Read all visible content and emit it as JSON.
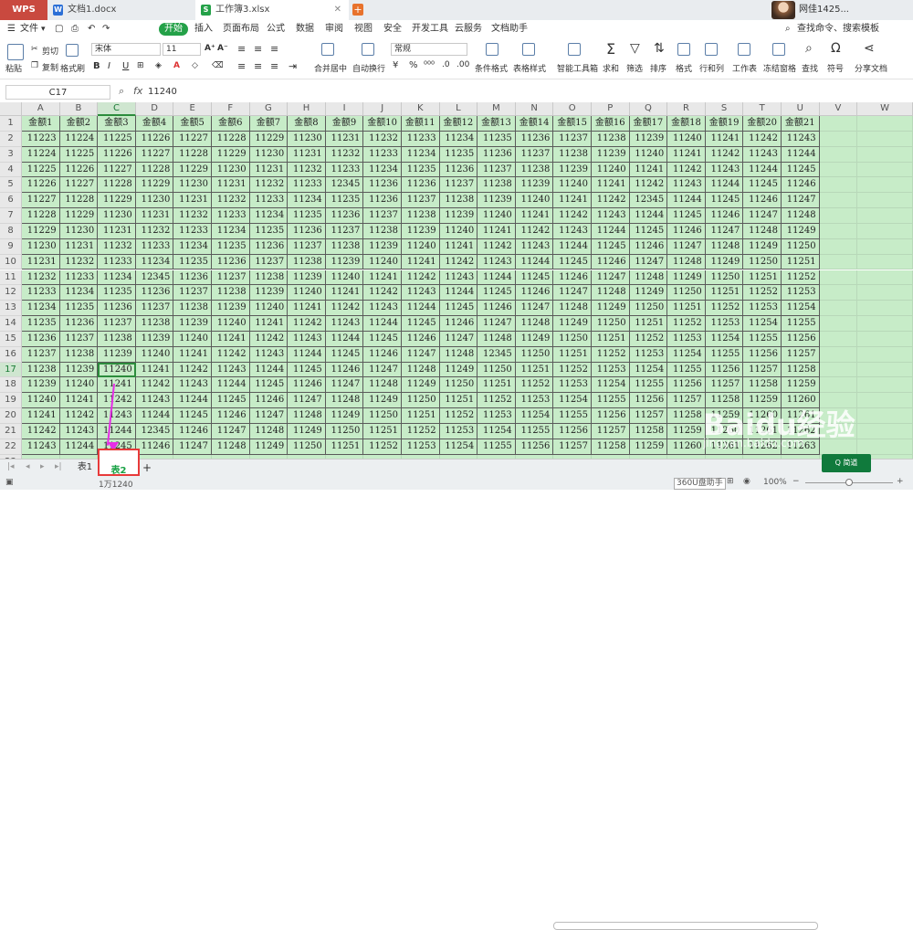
{
  "app": {
    "logo": "WPS",
    "tabs": [
      {
        "label": "文档1.docx",
        "icon": "W",
        "color": "#2b6fd6"
      },
      {
        "label": "工作簿3.xlsx",
        "icon": "S",
        "color": "#24a148"
      }
    ],
    "user_name": "网佳1425..."
  },
  "menu": {
    "file": "文件",
    "items": [
      "开始",
      "插入",
      "页面布局",
      "公式",
      "数据",
      "审阅",
      "视图",
      "安全",
      "开发工具",
      "云服务",
      "文档助手"
    ],
    "search": "查找命令、搜索模板"
  },
  "toolbar": {
    "paste": "粘贴",
    "cut": "剪切",
    "copy": "复制",
    "format_painter": "格式刷",
    "font_name": "宋体",
    "font_size": "11",
    "bold": "B",
    "italic": "I",
    "underline": "U",
    "merge": "合并居中",
    "wrap": "自动换行",
    "number_format": "常规",
    "cond_format": "条件格式",
    "table_style": "表格样式",
    "smart_toolbox": "智能工具箱",
    "sum": "求和",
    "filter": "筛选",
    "sort": "排序",
    "format": "格式",
    "row_col": "行和列",
    "worksheet": "工作表",
    "freeze": "冻结窗格",
    "find": "查找",
    "symbol": "符号",
    "share": "分享文档"
  },
  "formula_bar": {
    "cell_ref": "C17",
    "fx": "fx",
    "value": "11240"
  },
  "sheet": {
    "columns": [
      "A",
      "B",
      "C",
      "D",
      "E",
      "F",
      "G",
      "H",
      "I",
      "J",
      "K",
      "L",
      "M",
      "N",
      "O",
      "P",
      "Q",
      "R",
      "S",
      "T",
      "U",
      "V",
      "W"
    ],
    "selected_column": "C",
    "selected_row": "17",
    "rows": [
      [
        "金额1",
        "金额2",
        "金额3",
        "金额4",
        "金额5",
        "金额6",
        "金额7",
        "金额8",
        "金额9",
        "金额10",
        "金额11",
        "金额12",
        "金额13",
        "金额14",
        "金额15",
        "金额16",
        "金额17",
        "金额18",
        "金额19",
        "金额20",
        "金额21"
      ],
      [
        "11223",
        "11224",
        "11225",
        "11226",
        "11227",
        "11228",
        "11229",
        "11230",
        "11231",
        "11232",
        "11233",
        "11234",
        "11235",
        "11236",
        "11237",
        "11238",
        "11239",
        "11240",
        "11241",
        "11242",
        "11243"
      ],
      [
        "11224",
        "11225",
        "11226",
        "11227",
        "11228",
        "11229",
        "11230",
        "11231",
        "11232",
        "11233",
        "11234",
        "11235",
        "11236",
        "11237",
        "11238",
        "11239",
        "11240",
        "11241",
        "11242",
        "11243",
        "11244"
      ],
      [
        "11225",
        "11226",
        "11227",
        "11228",
        "11229",
        "11230",
        "11231",
        "11232",
        "11233",
        "11234",
        "11235",
        "11236",
        "11237",
        "11238",
        "11239",
        "11240",
        "11241",
        "11242",
        "11243",
        "11244",
        "11245"
      ],
      [
        "11226",
        "11227",
        "11228",
        "11229",
        "11230",
        "11231",
        "11232",
        "11233",
        "12345",
        "11236",
        "11236",
        "11237",
        "11238",
        "11239",
        "11240",
        "11241",
        "11242",
        "11243",
        "11244",
        "11245",
        "11246"
      ],
      [
        "11227",
        "11228",
        "11229",
        "11230",
        "11231",
        "11232",
        "11233",
        "11234",
        "11235",
        "11236",
        "11237",
        "11238",
        "11239",
        "11240",
        "11241",
        "11242",
        "12345",
        "11244",
        "11245",
        "11246",
        "11247"
      ],
      [
        "11228",
        "11229",
        "11230",
        "11231",
        "11232",
        "11233",
        "11234",
        "11235",
        "11236",
        "11237",
        "11238",
        "11239",
        "11240",
        "11241",
        "11242",
        "11243",
        "11244",
        "11245",
        "11246",
        "11247",
        "11248"
      ],
      [
        "11229",
        "11230",
        "11231",
        "11232",
        "11233",
        "11234",
        "11235",
        "11236",
        "11237",
        "11238",
        "11239",
        "11240",
        "11241",
        "11242",
        "11243",
        "11244",
        "11245",
        "11246",
        "11247",
        "11248",
        "11249"
      ],
      [
        "11230",
        "11231",
        "11232",
        "11233",
        "11234",
        "11235",
        "11236",
        "11237",
        "11238",
        "11239",
        "11240",
        "11241",
        "11242",
        "11243",
        "11244",
        "11245",
        "11246",
        "11247",
        "11248",
        "11249",
        "11250"
      ],
      [
        "11231",
        "11232",
        "11233",
        "11234",
        "11235",
        "11236",
        "11237",
        "11238",
        "11239",
        "11240",
        "11241",
        "11242",
        "11243",
        "11244",
        "11245",
        "11246",
        "11247",
        "11248",
        "11249",
        "11250",
        "11251"
      ],
      [
        "11232",
        "11233",
        "11234",
        "12345",
        "11236",
        "11237",
        "11238",
        "11239",
        "11240",
        "11241",
        "11242",
        "11243",
        "11244",
        "11245",
        "11246",
        "11247",
        "11248",
        "11249",
        "11250",
        "11251",
        "11252"
      ],
      [
        "11233",
        "11234",
        "11235",
        "11236",
        "11237",
        "11238",
        "11239",
        "11240",
        "11241",
        "11242",
        "11243",
        "11244",
        "11245",
        "11246",
        "11247",
        "11248",
        "11249",
        "11250",
        "11251",
        "11252",
        "11253"
      ],
      [
        "11234",
        "11235",
        "11236",
        "11237",
        "11238",
        "11239",
        "11240",
        "11241",
        "11242",
        "11243",
        "11244",
        "11245",
        "11246",
        "11247",
        "11248",
        "11249",
        "11250",
        "11251",
        "11252",
        "11253",
        "11254"
      ],
      [
        "11235",
        "11236",
        "11237",
        "11238",
        "11239",
        "11240",
        "11241",
        "11242",
        "11243",
        "11244",
        "11245",
        "11246",
        "11247",
        "11248",
        "11249",
        "11250",
        "11251",
        "11252",
        "11253",
        "11254",
        "11255"
      ],
      [
        "11236",
        "11237",
        "11238",
        "11239",
        "11240",
        "11241",
        "11242",
        "11243",
        "11244",
        "11245",
        "11246",
        "11247",
        "11248",
        "11249",
        "11250",
        "11251",
        "11252",
        "11253",
        "11254",
        "11255",
        "11256"
      ],
      [
        "11237",
        "11238",
        "11239",
        "11240",
        "11241",
        "11242",
        "11243",
        "11244",
        "11245",
        "11246",
        "11247",
        "11248",
        "12345",
        "11250",
        "11251",
        "11252",
        "11253",
        "11254",
        "11255",
        "11256",
        "11257"
      ],
      [
        "11238",
        "11239",
        "11240",
        "11241",
        "11242",
        "11243",
        "11244",
        "11245",
        "11246",
        "11247",
        "11248",
        "11249",
        "11250",
        "11251",
        "11252",
        "11253",
        "11254",
        "11255",
        "11256",
        "11257",
        "11258"
      ],
      [
        "11239",
        "11240",
        "11241",
        "11242",
        "11243",
        "11244",
        "11245",
        "11246",
        "11247",
        "11248",
        "11249",
        "11250",
        "11251",
        "11252",
        "11253",
        "11254",
        "11255",
        "11256",
        "11257",
        "11258",
        "11259"
      ],
      [
        "11240",
        "11241",
        "11242",
        "11243",
        "11244",
        "11245",
        "11246",
        "11247",
        "11248",
        "11249",
        "11250",
        "11251",
        "11252",
        "11253",
        "11254",
        "11255",
        "11256",
        "11257",
        "11258",
        "11259",
        "11260"
      ],
      [
        "11241",
        "11242",
        "11243",
        "11244",
        "11245",
        "11246",
        "11247",
        "11248",
        "11249",
        "11250",
        "11251",
        "11252",
        "11253",
        "11254",
        "11255",
        "11256",
        "11257",
        "11258",
        "11259",
        "11260",
        "11261"
      ],
      [
        "11242",
        "11243",
        "11244",
        "12345",
        "11246",
        "11247",
        "11248",
        "11249",
        "11250",
        "11251",
        "11252",
        "11253",
        "11254",
        "11255",
        "11256",
        "11257",
        "11258",
        "11259",
        "11260",
        "11261",
        "11262"
      ],
      [
        "11243",
        "11244",
        "11245",
        "11246",
        "11247",
        "11248",
        "11249",
        "11250",
        "11251",
        "11252",
        "11253",
        "11254",
        "11255",
        "11256",
        "11257",
        "11258",
        "11259",
        "11260",
        "11261",
        "11262",
        "11263"
      ]
    ],
    "row_numbers": [
      "1",
      "2",
      "3",
      "4",
      "5",
      "6",
      "7",
      "8",
      "9",
      "10",
      "11",
      "12",
      "13",
      "14",
      "15",
      "16",
      "17",
      "18",
      "19",
      "20",
      "21",
      "22",
      "23"
    ]
  },
  "sheet_tabs": [
    "表1",
    "表2"
  ],
  "active_sheet_tab": "表2",
  "status": {
    "left": "1万1240",
    "zoom": "100%",
    "tooltip": "360U盘助手",
    "promo": "Q 简道"
  },
  "watermark": {
    "brand": "Baidu经验",
    "url": "jingyan.baidu.com"
  },
  "colors": {
    "accent": "#24a148",
    "cell_fill": "#c7ecc8",
    "annotation": "#e62ee6",
    "highlight_box": "#e83a3a"
  }
}
